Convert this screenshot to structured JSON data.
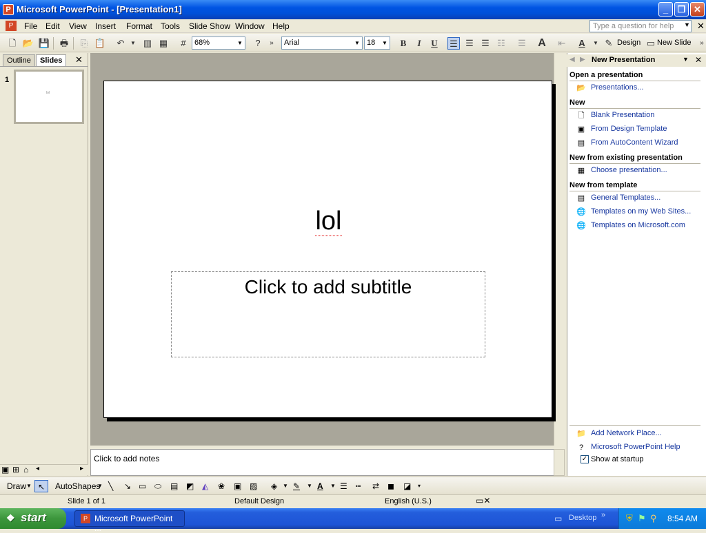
{
  "window": {
    "title": "Microsoft PowerPoint - [Presentation1]",
    "minimize": "_",
    "restore": "❐",
    "close": "✕"
  },
  "menu": {
    "items": [
      "File",
      "Edit",
      "View",
      "Insert",
      "Format",
      "Tools",
      "Slide Show",
      "Window",
      "Help"
    ],
    "help_placeholder": "Type a question for help"
  },
  "toolbar": {
    "zoom": "68%",
    "font": "Arial",
    "size": "18",
    "bold": "B",
    "italic": "I",
    "underline": "U",
    "design": "Design",
    "new_slide": "New Slide"
  },
  "left_panel": {
    "tab_outline": "Outline",
    "tab_slides": "Slides",
    "close": "✕",
    "slide_number": "1"
  },
  "slide": {
    "title": "lol",
    "subtitle": "Click to add subtitle"
  },
  "notes": "Click to add notes",
  "task_pane": {
    "title": "New Presentation",
    "open_heading": "Open a presentation",
    "open_link": "Presentations...",
    "new_heading": "New",
    "new_links": [
      "Blank Presentation",
      "From Design Template",
      "From AutoContent Wizard"
    ],
    "existing_heading": "New from existing presentation",
    "existing_link": "Choose presentation...",
    "template_heading": "New from template",
    "template_links": [
      "General Templates...",
      "Templates on my Web Sites...",
      "Templates on Microsoft.com"
    ],
    "bottom_links": [
      "Add Network Place...",
      "Microsoft PowerPoint Help"
    ],
    "show_startup": "Show at startup"
  },
  "drawbar": {
    "draw": "Draw",
    "autoshapes": "AutoShapes"
  },
  "status": {
    "slide": "Slide 1 of 1",
    "design": "Default Design",
    "language": "English (U.S.)"
  },
  "taskbar": {
    "start": "start",
    "item": "Microsoft PowerPoint ...",
    "desktop": "Desktop",
    "time": "8:54 AM"
  }
}
